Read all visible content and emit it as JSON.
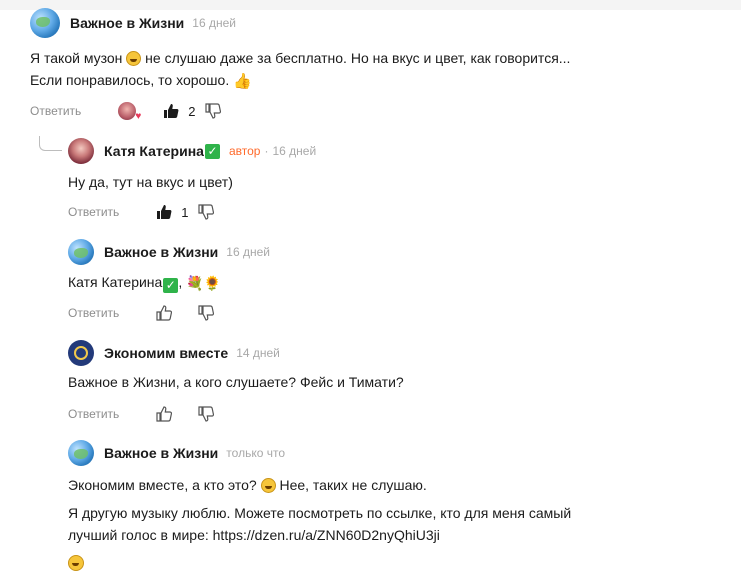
{
  "comments": [
    {
      "author": "Важное в Жизни",
      "time": "16 дней",
      "lines": [
        "Я такой музон",
        " не слушаю даже за бесплатно. Но на вкус и цвет, как говорится...",
        "Если понравилось, то хорошо."
      ],
      "reply_label": "Ответить",
      "likes": "2"
    },
    {
      "author": "Катя Катерина",
      "author_badge": "автор",
      "time": "16 дней",
      "text": "Ну да, тут на вкус и цвет)",
      "reply_label": "Ответить",
      "likes": "1"
    },
    {
      "author": "Важное в Жизни",
      "time": "16 дней",
      "text_prefix": "Катя Катерина",
      "text_suffix": ",",
      "reply_label": "Ответить"
    },
    {
      "author": "Экономим вместе",
      "time": "14 дней",
      "text": "Важное в Жизни, а кого слушаете? Фейс и Тимати?",
      "reply_label": "Ответить"
    },
    {
      "author": "Важное в Жизни",
      "time": "только что",
      "line1_a": "Экономим вместе, а кто это?",
      "line1_b": " Нее, таких не слушаю.",
      "line2": "Я другую музыку люблю. Можете посмотреть по ссылке, кто для меня самый",
      "line3_prefix": "лучший голос в мире: ",
      "link": "https://dzen.ru/a/ZNN60D2nyQhiU3ji"
    }
  ],
  "colors": {
    "author_badge": "#ff6a2b",
    "muted": "#8d8d8d",
    "check": "#2fb34a"
  },
  "icons": [
    "globe-avatar",
    "like-icon",
    "dislike-icon",
    "check-icon",
    "grin-emoji",
    "thumbs-up-emoji",
    "flower-emoji"
  ]
}
